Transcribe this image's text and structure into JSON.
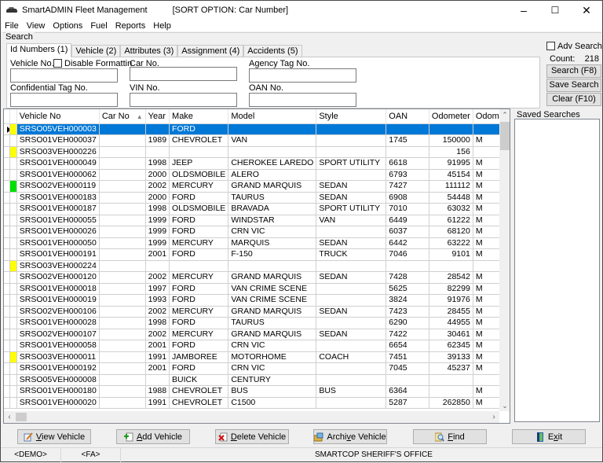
{
  "window": {
    "title": "SmartADMIN Fleet Management",
    "sort_option": "[SORT OPTION: Car Number]",
    "controls": {
      "minimize": "–",
      "maximize": "☐",
      "close": "✕"
    }
  },
  "menu": [
    "File",
    "View",
    "Options",
    "Fuel",
    "Reports",
    "Help"
  ],
  "search": {
    "legend": "Search",
    "tabs": [
      {
        "label": "Id Numbers (1)",
        "active": true
      },
      {
        "label": "Vehicle (2)",
        "active": false
      },
      {
        "label": "Attributes (3)",
        "active": false
      },
      {
        "label": "Assignment (4)",
        "active": false
      },
      {
        "label": "Accidents (5)",
        "active": false
      }
    ],
    "fields": {
      "vehicle_no": {
        "label": "Vehicle No.",
        "value": ""
      },
      "disable_formatting": {
        "label": "Disable Formattin",
        "checked": false
      },
      "car_no": {
        "label": "Car No.",
        "value": ""
      },
      "agency_tag_no": {
        "label": "Agency Tag No.",
        "value": ""
      },
      "confidential_tag_no": {
        "label": "Confidential Tag No.",
        "value": ""
      },
      "vin_no": {
        "label": "VIN No.",
        "value": ""
      },
      "oan_no": {
        "label": "OAN No.",
        "value": ""
      }
    },
    "adv_search": {
      "label": "Adv Search",
      "checked": false
    },
    "count_label": "Count:",
    "count_value": "218",
    "buttons": {
      "search": "Search (F8)",
      "save_search": "Save Search (F9)",
      "clear": "Clear (F10)"
    }
  },
  "grid": {
    "columns": [
      "Vehicle No",
      "Car No",
      "Year",
      "Make",
      "Model",
      "Style",
      "OAN",
      "Odometer",
      "Odomet"
    ],
    "sort_indicator": "▲",
    "rows": [
      {
        "marker": "#ffff00",
        "selected": true,
        "vehicle_no": "SRSO05VEH000003",
        "car_no": "",
        "year": "",
        "make": "FORD",
        "model": "",
        "style": "",
        "oan": "",
        "odometer": "",
        "odo_unit": ""
      },
      {
        "marker": "",
        "vehicle_no": "SRSO01VEH000037",
        "car_no": "",
        "year": "1989",
        "make": "CHEVROLET",
        "model": "VAN",
        "style": "",
        "oan": "1745",
        "odometer": "150000",
        "odo_unit": "M"
      },
      {
        "marker": "#ffff00",
        "vehicle_no": "SRSO03VEH000226",
        "car_no": "",
        "year": "",
        "make": "",
        "model": "",
        "style": "",
        "oan": "",
        "odometer": "156",
        "odo_unit": ""
      },
      {
        "marker": "",
        "vehicle_no": "SRSO01VEH000049",
        "car_no": "",
        "year": "1998",
        "make": "JEEP",
        "model": "CHEROKEE LAREDO",
        "style": "SPORT UTILITY",
        "oan": "6618",
        "odometer": "91995",
        "odo_unit": "M"
      },
      {
        "marker": "",
        "vehicle_no": "SRSO01VEH000062",
        "car_no": "",
        "year": "2000",
        "make": "OLDSMOBILE",
        "model": "ALERO",
        "style": "",
        "oan": "6793",
        "odometer": "45154",
        "odo_unit": "M"
      },
      {
        "marker": "#00e000",
        "vehicle_no": "SRSO02VEH000119",
        "car_no": "",
        "year": "2002",
        "make": "MERCURY",
        "model": "GRAND MARQUIS",
        "style": "SEDAN",
        "oan": "7427",
        "odometer": "111112",
        "odo_unit": "M"
      },
      {
        "marker": "",
        "vehicle_no": "SRSO01VEH000183",
        "car_no": "",
        "year": "2000",
        "make": "FORD",
        "model": "TAURUS",
        "style": "SEDAN",
        "oan": "6908",
        "odometer": "54448",
        "odo_unit": "M"
      },
      {
        "marker": "",
        "vehicle_no": "SRSO01VEH000187",
        "car_no": "",
        "year": "1998",
        "make": "OLDSMOBILE",
        "model": "BRAVADA",
        "style": "SPORT UTILITY",
        "oan": "7010",
        "odometer": "63032",
        "odo_unit": "M"
      },
      {
        "marker": "",
        "vehicle_no": "SRSO01VEH000055",
        "car_no": "",
        "year": "1999",
        "make": "FORD",
        "model": "WINDSTAR",
        "style": "VAN",
        "oan": "6449",
        "odometer": "61222",
        "odo_unit": "M"
      },
      {
        "marker": "",
        "vehicle_no": "SRSO01VEH000026",
        "car_no": "",
        "year": "1999",
        "make": "FORD",
        "model": "CRN VIC",
        "style": "",
        "oan": "6037",
        "odometer": "68120",
        "odo_unit": "M"
      },
      {
        "marker": "",
        "vehicle_no": "SRSO01VEH000050",
        "car_no": "",
        "year": "1999",
        "make": "MERCURY",
        "model": "MARQUIS",
        "style": "SEDAN",
        "oan": "6442",
        "odometer": "63222",
        "odo_unit": "M"
      },
      {
        "marker": "",
        "vehicle_no": "SRSO01VEH000191",
        "car_no": "",
        "year": "2001",
        "make": "FORD",
        "model": "F-150",
        "style": "TRUCK",
        "oan": "7046",
        "odometer": "9101",
        "odo_unit": "M"
      },
      {
        "marker": "#ffff00",
        "vehicle_no": "SRSO03VEH000224",
        "car_no": "",
        "year": "",
        "make": "",
        "model": "",
        "style": "",
        "oan": "",
        "odometer": "",
        "odo_unit": ""
      },
      {
        "marker": "",
        "vehicle_no": "SRSO02VEH000120",
        "car_no": "",
        "year": "2002",
        "make": "MERCURY",
        "model": "GRAND MARQUIS",
        "style": "SEDAN",
        "oan": "7428",
        "odometer": "28542",
        "odo_unit": "M"
      },
      {
        "marker": "",
        "vehicle_no": "SRSO01VEH000018",
        "car_no": "",
        "year": "1997",
        "make": "FORD",
        "model": "VAN CRIME SCENE",
        "style": "",
        "oan": "5625",
        "odometer": "82299",
        "odo_unit": "M"
      },
      {
        "marker": "",
        "vehicle_no": "SRSO01VEH000019",
        "car_no": "",
        "year": "1993",
        "make": "FORD",
        "model": "VAN CRIME SCENE",
        "style": "",
        "oan": "3824",
        "odometer": "91976",
        "odo_unit": "M"
      },
      {
        "marker": "",
        "vehicle_no": "SRSO02VEH000106",
        "car_no": "",
        "year": "2002",
        "make": "MERCURY",
        "model": "GRAND MARQUIS",
        "style": "SEDAN",
        "oan": "7423",
        "odometer": "28455",
        "odo_unit": "M"
      },
      {
        "marker": "",
        "vehicle_no": "SRSO01VEH000028",
        "car_no": "",
        "year": "1998",
        "make": "FORD",
        "model": "TAURUS",
        "style": "",
        "oan": "6290",
        "odometer": "44955",
        "odo_unit": "M"
      },
      {
        "marker": "",
        "vehicle_no": "SRSO02VEH000107",
        "car_no": "",
        "year": "2002",
        "make": "MERCURY",
        "model": "GRAND MARQUIS",
        "style": "SEDAN",
        "oan": "7422",
        "odometer": "30461",
        "odo_unit": "M"
      },
      {
        "marker": "",
        "vehicle_no": "SRSO01VEH000058",
        "car_no": "",
        "year": "2001",
        "make": "FORD",
        "model": "CRN VIC",
        "style": "",
        "oan": "6654",
        "odometer": "62345",
        "odo_unit": "M"
      },
      {
        "marker": "#ffff00",
        "vehicle_no": "SRSO03VEH000011",
        "car_no": "",
        "year": "1991",
        "make": "JAMBOREE",
        "model": "MOTORHOME",
        "style": "COACH",
        "oan": "7451",
        "odometer": "39133",
        "odo_unit": "M"
      },
      {
        "marker": "",
        "vehicle_no": "SRSO01VEH000192",
        "car_no": "",
        "year": "2001",
        "make": "FORD",
        "model": "CRN VIC",
        "style": "",
        "oan": "7045",
        "odometer": "45237",
        "odo_unit": "M"
      },
      {
        "marker": "",
        "vehicle_no": "SRSO05VEH000008",
        "car_no": "",
        "year": "",
        "make": "BUICK",
        "model": "CENTURY",
        "style": "",
        "oan": "",
        "odometer": "",
        "odo_unit": ""
      },
      {
        "marker": "",
        "vehicle_no": "SRSO01VEH000180",
        "car_no": "",
        "year": "1988",
        "make": "CHEVROLET",
        "model": "BUS",
        "style": "BUS",
        "oan": "6364",
        "odometer": "",
        "odo_unit": "M"
      },
      {
        "marker": "",
        "vehicle_no": "SRSO01VEH000020",
        "car_no": "",
        "year": "1991",
        "make": "CHEVROLET",
        "model": "C1500",
        "style": "",
        "oan": "5287",
        "odometer": "262850",
        "odo_unit": "M"
      }
    ]
  },
  "saved_searches": {
    "legend": "Saved Searches",
    "items": []
  },
  "actions": [
    {
      "id": "view-vehicle",
      "pre": "",
      "key": "V",
      "post": "iew Vehicle",
      "icon": "edit-icon"
    },
    {
      "id": "add-vehicle",
      "pre": "",
      "key": "A",
      "post": "dd Vehicle",
      "icon": "add-document-icon"
    },
    {
      "id": "delete-vehicle",
      "pre": "",
      "key": "D",
      "post": "elete Vehicle",
      "icon": "delete-document-icon"
    },
    {
      "id": "archive-vehicle",
      "pre": "Archi",
      "key": "v",
      "post": "e Vehicle",
      "icon": "archive-icon"
    },
    {
      "id": "find",
      "pre": "",
      "key": "F",
      "post": "ind",
      "icon": "magnifier-icon"
    },
    {
      "id": "exit",
      "pre": "E",
      "key": "x",
      "post": "it",
      "icon": "exit-door-icon"
    }
  ],
  "status": {
    "db": "<DEMO>",
    "user": "<FA>",
    "agency": "SMARTCOP SHERIFF'S OFFICE"
  },
  "colors": {
    "selection": "#0078d7",
    "marker_yellow": "#ffff00",
    "marker_green": "#00e000"
  }
}
